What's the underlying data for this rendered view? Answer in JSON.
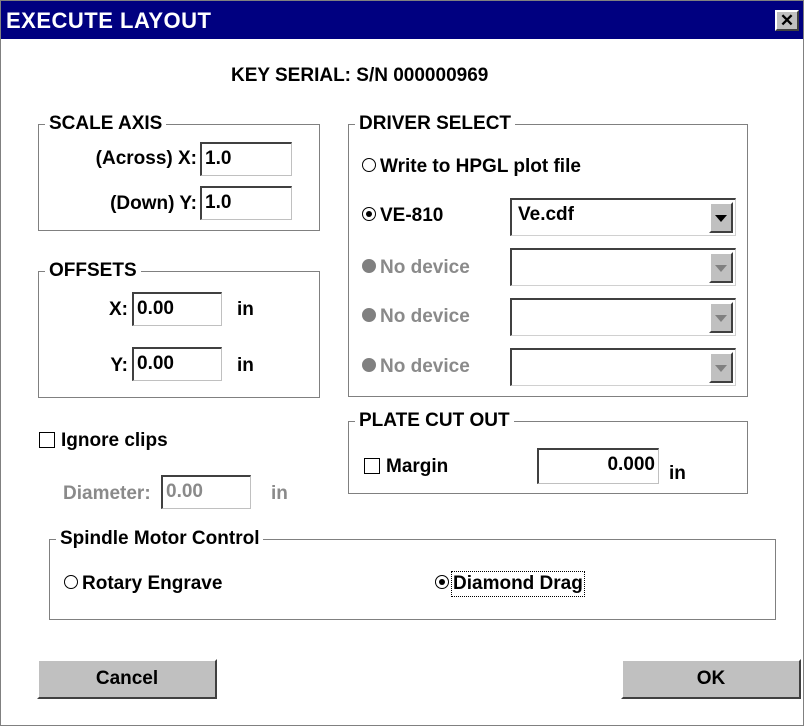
{
  "window": {
    "title": "EXECUTE LAYOUT",
    "close_symbol": "✕"
  },
  "key_serial": "KEY SERIAL: S/N 000000969",
  "scale_axis": {
    "label": "SCALE AXIS",
    "x_label": "(Across) X:",
    "x_value": "1.0",
    "y_label": "(Down) Y:",
    "y_value": "1.0"
  },
  "offsets": {
    "label": "OFFSETS",
    "x_label": "X:",
    "x_value": "0.00",
    "x_unit": "in",
    "y_label": "Y:",
    "y_value": "0.00",
    "y_unit": "in"
  },
  "ignore_clips": {
    "label": "Ignore clips",
    "checked": false
  },
  "diameter": {
    "label": "Diameter:",
    "value": "0.00",
    "unit": "in"
  },
  "driver_select": {
    "label": "DRIVER SELECT",
    "options": [
      {
        "label": "Write to HPGL plot file",
        "selected": false,
        "enabled": true
      },
      {
        "label": "VE-810",
        "selected": true,
        "enabled": true,
        "combo_value": "Ve.cdf"
      },
      {
        "label": "No device",
        "selected": false,
        "enabled": false,
        "combo_value": ""
      },
      {
        "label": "No device",
        "selected": false,
        "enabled": false,
        "combo_value": ""
      },
      {
        "label": "No device",
        "selected": false,
        "enabled": false,
        "combo_value": ""
      }
    ]
  },
  "plate_cut_out": {
    "label": "PLATE CUT OUT",
    "margin_label": "Margin",
    "margin_checked": false,
    "margin_value": "0.000",
    "margin_unit": "in"
  },
  "spindle": {
    "label": "Spindle Motor Control",
    "options": [
      {
        "label": "Rotary Engrave",
        "selected": false
      },
      {
        "label": "Diamond Drag",
        "selected": true
      }
    ]
  },
  "buttons": {
    "cancel": "Cancel",
    "ok": "OK"
  }
}
